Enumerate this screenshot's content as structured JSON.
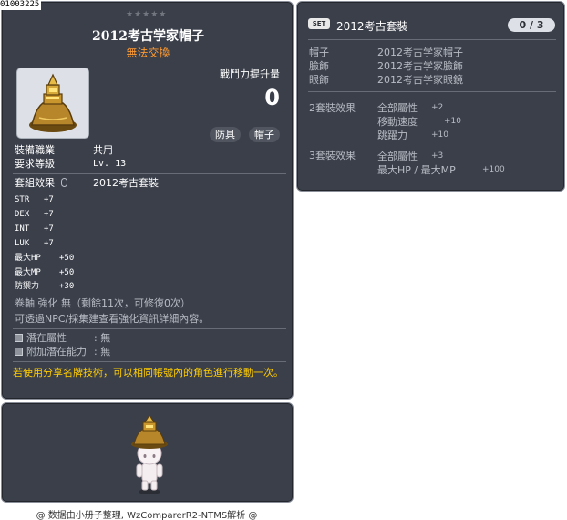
{
  "item_id": "01003225",
  "main": {
    "stars": "★★★★★",
    "name": "2012考古学家帽子",
    "trade": "無法交換",
    "icon": "golden-bell-hat-icon",
    "power_label": "戰鬥力提升量",
    "power_value": "0",
    "tags": [
      "防具",
      "帽子"
    ],
    "job_label": "裝備職業",
    "job_value": "共用",
    "level_label": "要求等級",
    "level_value": "Lv. 13",
    "set_label": "套組效果",
    "set_value": "2012考古套裝",
    "stats": [
      {
        "name": "STR",
        "value": "+7"
      },
      {
        "name": "DEX",
        "value": "+7"
      },
      {
        "name": "INT",
        "value": "+7"
      },
      {
        "name": "LUK",
        "value": "+7"
      },
      {
        "name": "最大HP",
        "value": "+50"
      },
      {
        "name": "最大MP",
        "value": "+50"
      },
      {
        "name": "防禦力",
        "value": "+30"
      }
    ],
    "scroll_text": "卷軸 強化 無（剩餘11次，可修復0次）",
    "enhance_info": "可透過NPC/採集建查看強化資訊詳細內容。",
    "potential_label": "潛在屬性",
    "potential_value": ": 無",
    "bonus_potential_label": "附加潛在能力",
    "bonus_potential_value": ": 無",
    "notice": "若使用分享名牌技術，可以相同帳號內的角色進行移動一次。"
  },
  "set_panel": {
    "badge": "SET",
    "name": "2012考古套裝",
    "count": "0 / 3",
    "items": [
      {
        "slot": "帽子",
        "name": "2012考古学家帽子"
      },
      {
        "slot": "臉飾",
        "name": "2012考古学家臉飾"
      },
      {
        "slot": "眼飾",
        "name": "2012考古学家眼鏡"
      }
    ],
    "effects": [
      {
        "label": "2套裝效果",
        "lines": [
          {
            "stat": "全部屬性",
            "value": "+2"
          },
          {
            "stat": "移動速度",
            "value": "+10"
          },
          {
            "stat": "跳躍力",
            "value": "+10"
          }
        ]
      },
      {
        "label": "3套裝效果",
        "lines": [
          {
            "stat": "全部屬性",
            "value": "+3"
          },
          {
            "stat": "最大HP / 最大MP",
            "value": "+100"
          }
        ]
      }
    ]
  },
  "footer": "@ 数据由小册子整理, WzComparerR2-NTMS解析 @",
  "colors": {
    "panel_bg": "#3a3f4a",
    "trade_orange": "#ff9a30",
    "notice_yellow": "#ffcc00",
    "muted_text": "#b8bcc4"
  }
}
